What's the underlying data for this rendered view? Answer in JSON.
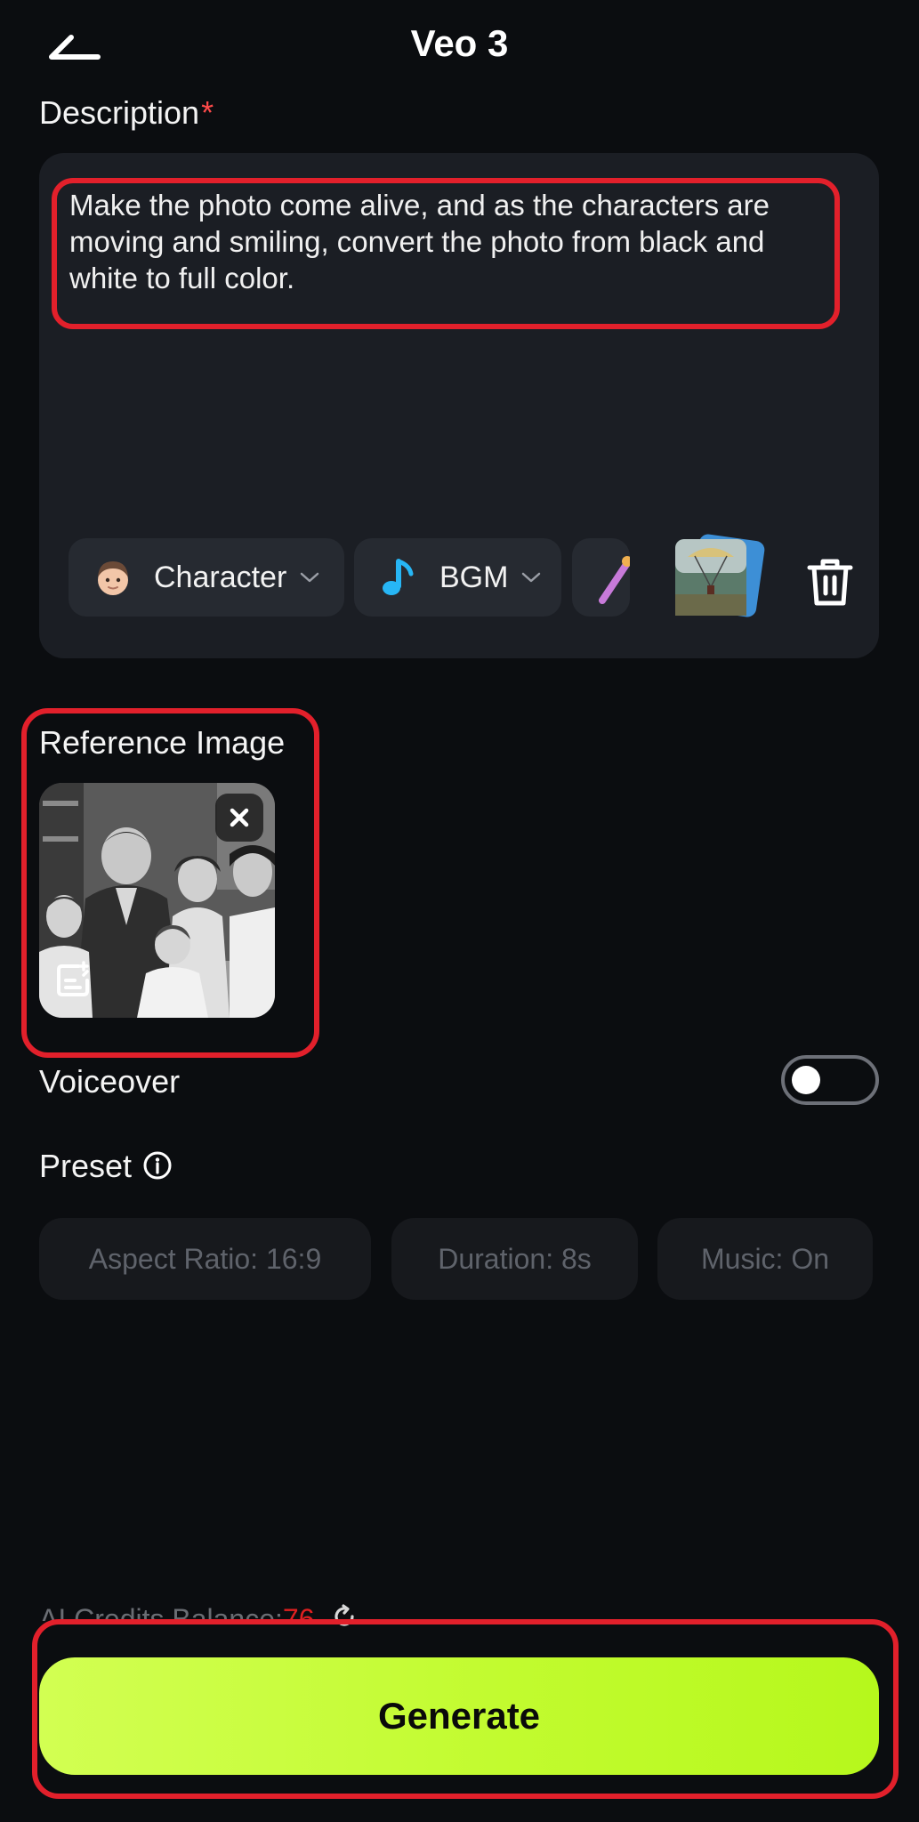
{
  "header": {
    "title": "Veo 3",
    "back_icon": "arrow-left-icon"
  },
  "description": {
    "label": "Description",
    "required_mark": "*",
    "text": "Make the photo come alive, and as the characters are moving and smiling, convert the photo from black and white to full color."
  },
  "chips": [
    {
      "label": "Character",
      "icon": "character-face-icon"
    },
    {
      "label": "BGM",
      "icon": "music-note-icon"
    },
    {
      "label": "",
      "icon": "magic-wand-icon"
    }
  ],
  "reference": {
    "label": "Reference Image"
  },
  "voiceover": {
    "label": "Voiceover",
    "enabled": false
  },
  "preset": {
    "label": "Preset",
    "options": [
      "Aspect Ratio: 16:9",
      "Duration: 8s",
      "Music: On"
    ]
  },
  "credits": {
    "label": "AI Credits Balance:",
    "value": "76"
  },
  "generate": {
    "label": "Generate"
  },
  "colors": {
    "background": "#0b0d10",
    "card": "#1b1e24",
    "accent": "#c2fb2f",
    "annotation": "#e2202b",
    "required": "#ff4a4a"
  }
}
